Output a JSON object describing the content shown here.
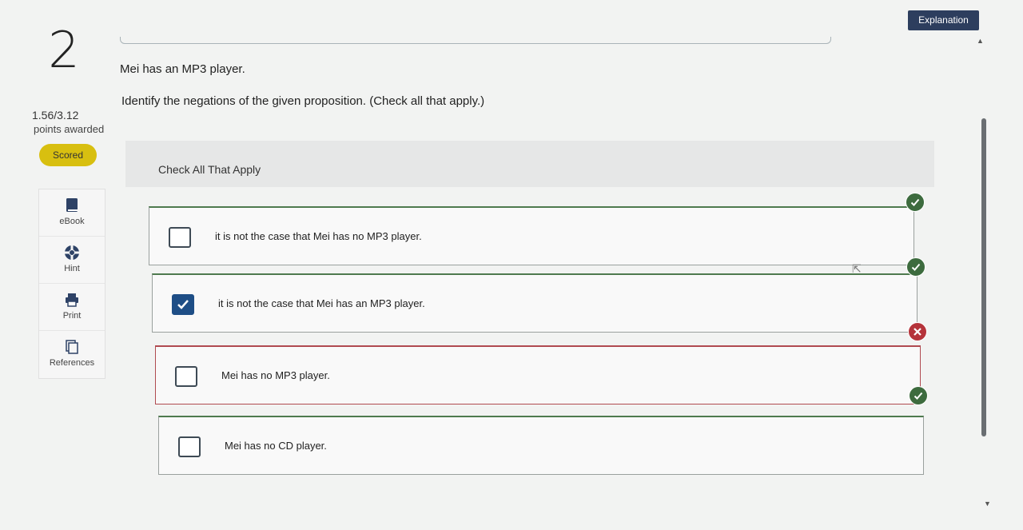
{
  "question": {
    "number": "2",
    "points": "1.56/3.12",
    "points_label": "points awarded",
    "status": "Scored",
    "stem": "Mei has an MP3 player.",
    "instruction": "Identify the negations of the given proposition. (Check all that apply.)",
    "header": "Check All That Apply"
  },
  "tools": [
    {
      "label": "eBook",
      "icon": "book-icon"
    },
    {
      "label": "Hint",
      "icon": "lifebuoy-icon"
    },
    {
      "label": "Print",
      "icon": "printer-icon"
    },
    {
      "label": "References",
      "icon": "documents-icon"
    }
  ],
  "options": [
    {
      "text": "it is not the case that Mei has no MP3 player.",
      "checked": false,
      "result": "correct"
    },
    {
      "text": "it is not the case that Mei has an MP3 player.",
      "checked": true,
      "result": "correct"
    },
    {
      "text": "Mei has no MP3 player.",
      "checked": false,
      "result": "incorrect"
    },
    {
      "text": "Mei has no CD player.",
      "checked": false,
      "result": "correct"
    }
  ],
  "explanation_button": "Explanation",
  "colors": {
    "accent": "#2d3e5e",
    "checkbox_checked": "#1e4e86",
    "correct": "#3d6b3e",
    "incorrect": "#b5333a",
    "scored_badge": "#d8bf10"
  }
}
